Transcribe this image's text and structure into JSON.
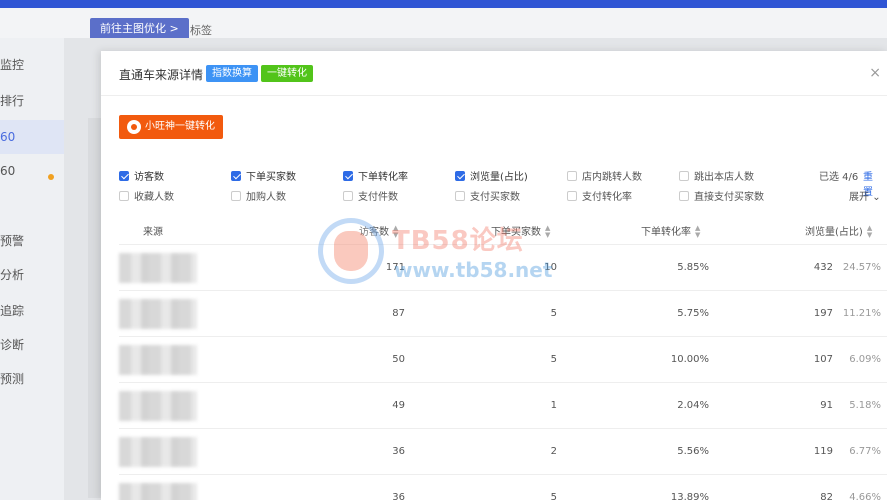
{
  "background": {
    "tab_button": "前往主图优化 >",
    "tab_text": "标签",
    "sidebar_items": [
      "监控",
      "排行",
      "60",
      "60",
      "预警",
      "分析",
      "追踪",
      "诊断",
      "预测"
    ]
  },
  "modal": {
    "title": "直通车来源详情",
    "index_button": "指数换算",
    "convert_button": "一键转化",
    "close_icon": "×",
    "wangwang_button": "小旺神一键转化"
  },
  "metrics": {
    "items": [
      {
        "label": "访客数",
        "checked": true
      },
      {
        "label": "下单买家数",
        "checked": true
      },
      {
        "label": "下单转化率",
        "checked": true
      },
      {
        "label": "浏览量(占比)",
        "checked": true
      },
      {
        "label": "店内跳转人数",
        "checked": false
      },
      {
        "label": "跳出本店人数",
        "checked": false
      },
      {
        "label": "收藏人数",
        "checked": false
      },
      {
        "label": "加购人数",
        "checked": false
      },
      {
        "label": "支付件数",
        "checked": false
      },
      {
        "label": "支付买家数",
        "checked": false
      },
      {
        "label": "支付转化率",
        "checked": false
      },
      {
        "label": "直接支付买家数",
        "checked": false
      }
    ],
    "selected_count": "已选 4/6",
    "reset_label": "重置",
    "expand_label": "展开"
  },
  "table": {
    "columns": [
      "来源",
      "访客数",
      "下单买家数",
      "下单转化率",
      "浏览量",
      "(占比)"
    ],
    "rows": [
      {
        "visitors": "171",
        "buyers": "10",
        "conversion": "5.85%",
        "pageviews": "432",
        "share": "24.57%"
      },
      {
        "visitors": "87",
        "buyers": "5",
        "conversion": "5.75%",
        "pageviews": "197",
        "share": "11.21%"
      },
      {
        "visitors": "50",
        "buyers": "5",
        "conversion": "10.00%",
        "pageviews": "107",
        "share": "6.09%"
      },
      {
        "visitors": "49",
        "buyers": "1",
        "conversion": "2.04%",
        "pageviews": "91",
        "share": "5.18%"
      },
      {
        "visitors": "36",
        "buyers": "2",
        "conversion": "5.56%",
        "pageviews": "119",
        "share": "6.77%"
      },
      {
        "visitors": "36",
        "buyers": "5",
        "conversion": "13.89%",
        "pageviews": "82",
        "share": "4.66%"
      }
    ]
  },
  "watermark": {
    "title": "TB58论坛",
    "url": "www.tb58.net"
  }
}
